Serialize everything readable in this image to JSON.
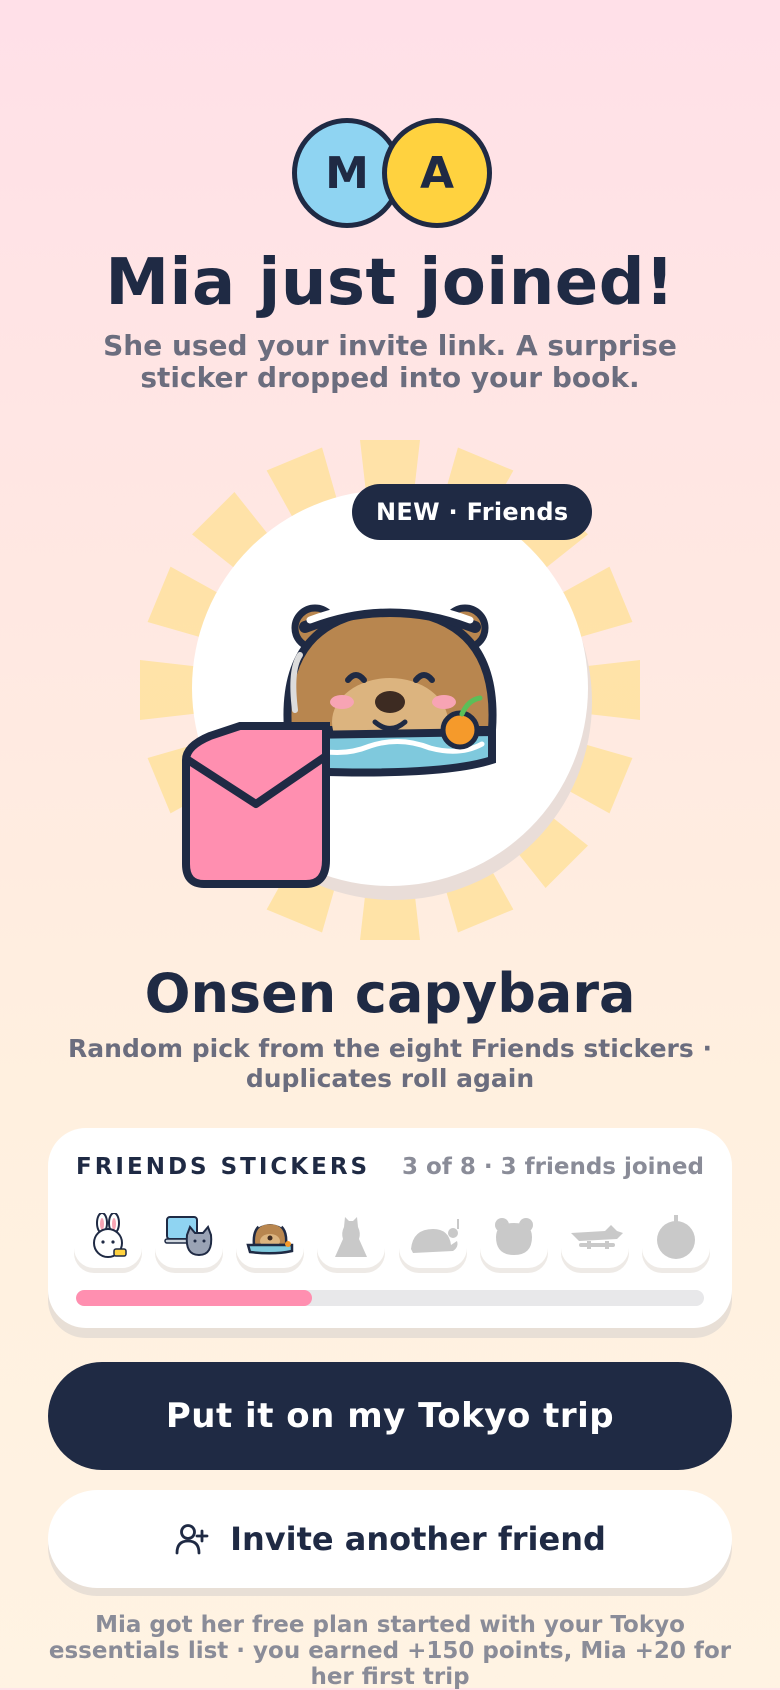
{
  "header": {
    "avatars": [
      "M",
      "A"
    ],
    "title": "Mia just joined!",
    "subtitle": "She used your invite link. A surprise sticker dropped into your book."
  },
  "sticker": {
    "badge": "NEW · Friends",
    "name": "Onsen capybara",
    "note": "Random pick from the eight Friends stickers · duplicates roll again"
  },
  "collection": {
    "title": "FRIENDS STICKERS",
    "count": "3 of 8 · 3 friends joined",
    "progress_fraction": 0.375,
    "slots": [
      {
        "icon": "bunny-sticker-icon",
        "collected": true
      },
      {
        "icon": "cat-laptop-sticker-icon",
        "collected": true
      },
      {
        "icon": "capybara-sticker-icon",
        "collected": true
      },
      {
        "icon": "locked-figure-icon",
        "collected": false
      },
      {
        "icon": "locked-turtle-icon",
        "collected": false
      },
      {
        "icon": "locked-bear-icon",
        "collected": false
      },
      {
        "icon": "locked-plane-icon",
        "collected": false
      },
      {
        "icon": "locked-orb-icon",
        "collected": false
      }
    ],
    "accent": "#ff8fb0"
  },
  "actions": {
    "primary": "Put it on my Tokyo trip",
    "secondary": "Invite another friend"
  },
  "footer": "Mia got her free plan started with your Tokyo essentials list · you earned +150 points, Mia +20 for her first trip",
  "colors": {
    "navy": "#1f2a44",
    "sky": "#8fd4f2",
    "yellow": "#ffd23f",
    "pink": "#ff8fb0"
  }
}
